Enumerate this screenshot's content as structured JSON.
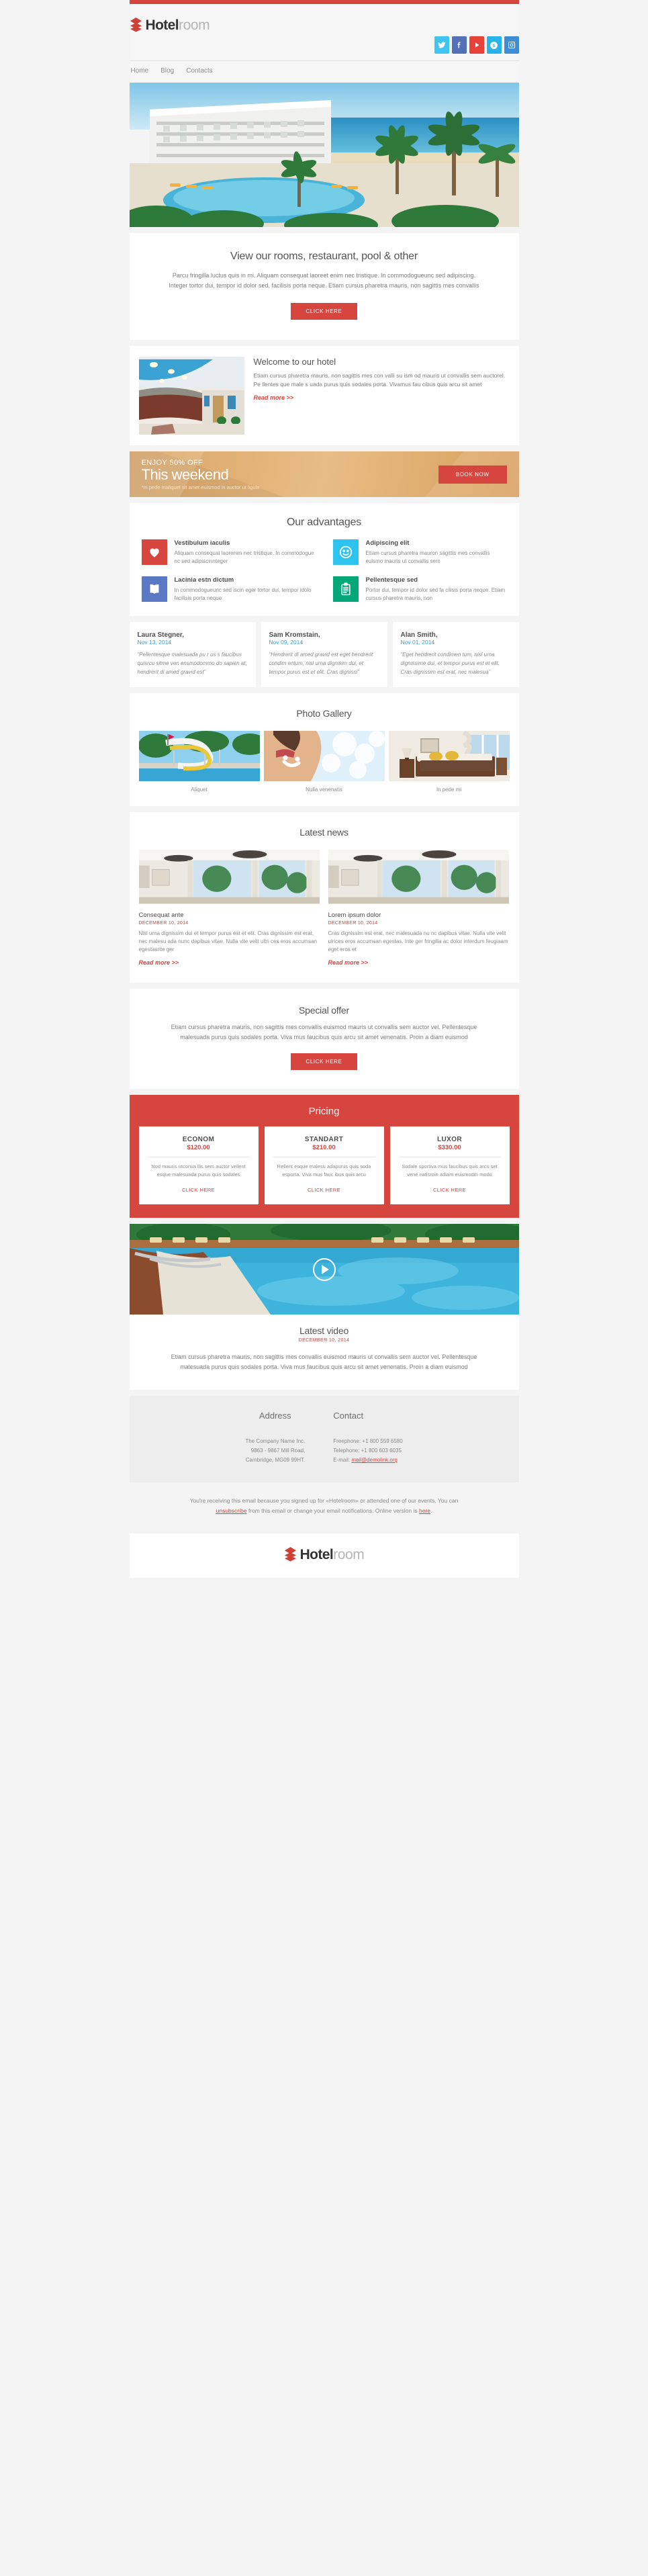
{
  "brand": {
    "name_bold": "Hotel",
    "name_light": "room"
  },
  "social": [
    {
      "name": "twitter",
      "glyph": "ᵗ",
      "label": "Twitter",
      "color": "#40c4f0"
    },
    {
      "name": "facebook",
      "glyph": "f",
      "label": "Facebook",
      "color": "#5471b8"
    },
    {
      "name": "youtube",
      "glyph": "▶",
      "label": "YouTube",
      "color": "#e8413a"
    },
    {
      "name": "skype",
      "glyph": "S",
      "label": "Skype",
      "color": "#28b4e8"
    },
    {
      "name": "instagram",
      "glyph": "▢",
      "label": "Instagram",
      "color": "#3f8bd4"
    }
  ],
  "nav": [
    {
      "label": "Home"
    },
    {
      "label": "Blog"
    },
    {
      "label": "Contacts"
    }
  ],
  "intro": {
    "title": "View our rooms, restaurant, pool & other",
    "text": "Parcu fringilla luctus quis in mi. Aliquam consequat laoreet enim nec tristique. In commodogueunc sed adipiscing. Integer tortor dui, tempor id dolor sed, facilisis porta neque. Etiam cursus pharetra mauris, non sagittis mes convallis",
    "cta": "CLICK HERE"
  },
  "welcome": {
    "title": "Welcome to our hotel",
    "text": "Etiam cursus pharetra mauris, non sagittis mes con valli su ism od mauris ut convallis sem auctorel. Pe llentes que male s uada purus quis sodales porta. Vivamus fau cibus quis arcu sit amet",
    "readmore": "Read more >>"
  },
  "promo": {
    "kicker": "ENJOY 50% OFF",
    "headline": "This weekend",
    "note": "*In pede maliquet sit amet euismod in auctor ut ligula",
    "cta": "BOOK NOW"
  },
  "advantages": {
    "title": "Our advantages",
    "items": [
      {
        "icon": "heart-icon",
        "glyph": "♥",
        "color": "#d6453e",
        "title": "Vestibulum iaculis",
        "text": "Aliquam consequat laorenim nec tristique. In commodogue nc sed adipiscinnteger"
      },
      {
        "icon": "smiley-icon",
        "glyph": "☺",
        "color": "#2ec2ef",
        "title": "Adipiscing elit",
        "text": "Etiam cursus pharetra mauron sagittis mes convallis euismo mauris ut convallis sem"
      },
      {
        "icon": "book-icon",
        "glyph": "☷",
        "color": "#5a79c4",
        "title": "Lacinia estn dictum",
        "text": "In commodogueunc sed iscin eger tortor dui, tempor idolo facilisis porta neque"
      },
      {
        "icon": "clipboard-icon",
        "glyph": "☰",
        "color": "#00a878",
        "title": "Pellentesque sed",
        "text": "Portor dui, tempor id dolor sed fa cilisis porta neque. Etiam cursus pharetra mauris, non"
      }
    ]
  },
  "testimonials": [
    {
      "name": "Laura Stegner,",
      "date": "Nov 13, 2014",
      "quote": "“Pellentesque malesuada pu r us s faucibus quisrcu sitme ven ensmodommo do sapien at, hendrerit di amed gravid est”"
    },
    {
      "name": "Sam Kromstain,",
      "date": "Nov 09, 2014",
      "quote": "“Hendrerit di amed gravid est eget hendrerit condim entum, nisl urna dignisim dui, et tempor purus est et elit. Cras dignissi”"
    },
    {
      "name": "Alan Smith,",
      "date": "Nov 01, 2014",
      "quote": "“Eget hendrerit condimen tum, nisl urna dignissime dui, et tempor purus est et elit. Cras dignissim est erat, nec malesua”"
    }
  ],
  "gallery": {
    "title": "Photo Gallery",
    "items": [
      {
        "caption": "Aliquet",
        "scene": "waterslide"
      },
      {
        "caption": "Nulla venenatis",
        "scene": "suncream"
      },
      {
        "caption": "In pede mi",
        "scene": "bedroom"
      }
    ]
  },
  "news": {
    "title": "Latest news",
    "items": [
      {
        "title": "Consequat ante",
        "date": "DECEMBER 10, 2014",
        "text": "Nisl urna dignissim dui et tempor purus est et elit. Cras dignissim est erat, nec malesu ada nunc dapibus vitae. Nulla vite velit ultri ces eros accumsan egestasnte ger",
        "readmore": "Read more >>"
      },
      {
        "title": "Lorem ipsum dolor",
        "date": "DECEMBER 10, 2014",
        "text": "Cras dignissim est erat, nec malesuada nu nc dapibus vitae. Nulla vite velit ulrices eros accumsan egestas. Inte ger fringilla ac dolor interdum feugiaam eget eros et",
        "readmore": "Read more >>"
      }
    ]
  },
  "special": {
    "title": "Special offer",
    "text": "Etiam cursus pharetra mauris, non sagittis mes convallis euismod mauris ut convallis sem auctor vel. Pellentesque malesuada purus quis sodales porta. Viva mus faucibus quis arcu sit amet venenatis. Proin a diam euismod",
    "cta": "CLICK HERE"
  },
  "pricing": {
    "title": "Pricing",
    "plans": [
      {
        "name": "ECONOM",
        "price": "$120.00",
        "text": "Nod mauris utconva llis sem auctor vellent esque malesuada purus quis sodales",
        "cta": "CLICK HERE"
      },
      {
        "name": "STANDART",
        "price": "$210.00",
        "text": "Rellent esque malesu adapurus quis soda esporta. Viva mus fauc ibus quis arcu",
        "cta": "CLICK HERE"
      },
      {
        "name": "LUXOR",
        "price": "$330.00",
        "text": "Sodale sportiva mus faucibus quis arcu set vene natisroin adiam euismodm modo",
        "cta": "CLICK HERE"
      }
    ]
  },
  "video": {
    "title": "Latest video",
    "date": "DECEMBER 10, 2014",
    "text": "Etiam cursus pharetra mauris, non sagittis mes convallis euismod mauris ut convallis sem auctor vel. Pellentesque malesuada purus quis sodales porta. Viva mus faucibus quis arcu sit amet venenatis. Proin a diam euismod"
  },
  "footer": {
    "address": {
      "heading": "Address",
      "line1": "The Company Name Inc.",
      "line2": "9863 - 9867 Mill Road,",
      "line3": "Cambridge, MG09 99HT."
    },
    "contact": {
      "heading": "Contact",
      "freephone": "Freephone: +1 800 559 6580",
      "telephone": "Telephone: +1 800 603 6035",
      "email_label": "E-mail:",
      "email": "mail@demolink.org"
    },
    "disclaimer_1": "You're receiving this email because you signed up for «Hotelroom» or attended one of our events. You can ",
    "disclaimer_link1": "unsubscribe",
    "disclaimer_2": " from this email or change your email notifications. Online version is ",
    "disclaimer_link2": "here",
    "disclaimer_3": "."
  },
  "colors": {
    "accent": "#d6453e",
    "link": "#3aa0d8",
    "promo": "#dfae70"
  }
}
